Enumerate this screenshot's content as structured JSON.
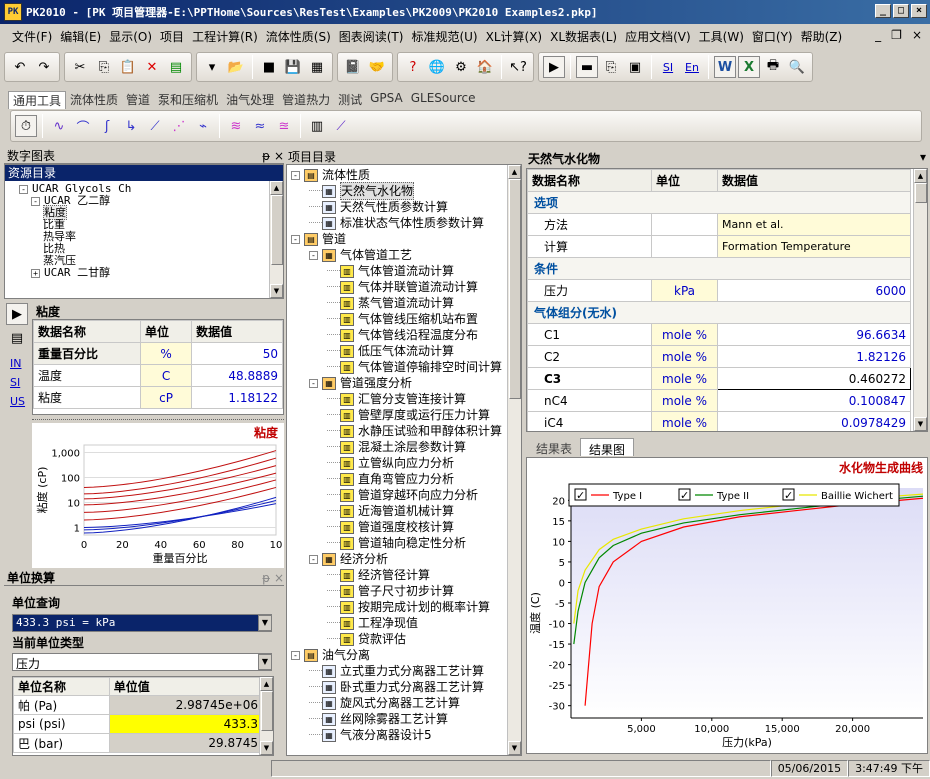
{
  "window": {
    "title": "PK2010 - [PK 项目管理器-E:\\PPTHome\\Sources\\ResTest\\Examples\\PK2009\\PK2010 Examples2.pkp]",
    "logo": "PK"
  },
  "menu": [
    "文件(F)",
    "编辑(E)",
    "显示(O)",
    "项目",
    "工程计算(R)",
    "流体性质(S)",
    "图表阅读(T)",
    "标准规范(U)",
    "XL计算(X)",
    "XL数据表(L)",
    "应用文档(V)",
    "工具(W)",
    "窗口(Y)",
    "帮助(Z)"
  ],
  "toolbar_tabs": [
    "通用工具",
    "流体性质",
    "管道",
    "泵和压缩机",
    "油气处理",
    "管道热力",
    "测试",
    "GPSA",
    "GLESource"
  ],
  "left_panel": {
    "title": "数字图表",
    "resource_header": "资源目录",
    "tree": [
      {
        "t": "UCAR Glycols Ch",
        "indent": 1,
        "exp": "-"
      },
      {
        "t": "UCAR 乙二醇",
        "indent": 2,
        "exp": "-"
      },
      {
        "t": "粘度",
        "indent": 3,
        "sel": true
      },
      {
        "t": "比重",
        "indent": 3
      },
      {
        "t": "热导率",
        "indent": 3
      },
      {
        "t": "比热",
        "indent": 3
      },
      {
        "t": "蒸汽压",
        "indent": 3
      },
      {
        "t": "UCAR 二甘醇",
        "indent": 2,
        "exp": "+"
      }
    ],
    "side_buttons": [
      "IN",
      "SI",
      "US"
    ],
    "viscosity_title": "粘度",
    "viscosity_table": {
      "headers": [
        "数据名称",
        "单位",
        "数据值"
      ],
      "rows": [
        [
          "重量百分比",
          "%",
          "50"
        ],
        [
          "温度",
          "C",
          "48.8889"
        ],
        [
          "粘度",
          "cP",
          "1.18122"
        ]
      ]
    },
    "chart_title": "粘度"
  },
  "unit_panel": {
    "title": "单位换算",
    "query_label": "单位查询",
    "query_value": "433.3 psi = kPa",
    "type_label": "当前单位类型",
    "type_value": "压力",
    "headers": [
      "单位名称",
      "单位值"
    ],
    "rows": [
      [
        "帕 (Pa)",
        "2.98745e+06"
      ],
      [
        "psi (psi)",
        "433.3"
      ],
      [
        "巴 (bar)",
        "29.8745"
      ]
    ]
  },
  "project": {
    "title": "项目目录",
    "items": [
      {
        "t": "流体性质",
        "lvl": 0,
        "exp": "-"
      },
      {
        "t": "天然气水化物",
        "lvl": 1,
        "sel": true
      },
      {
        "t": "天然气性质参数计算",
        "lvl": 1
      },
      {
        "t": "标准状态气体性质参数计算",
        "lvl": 1
      },
      {
        "t": "管道",
        "lvl": 0,
        "exp": "-"
      },
      {
        "t": "气体管道工艺",
        "lvl": 1,
        "exp": "-"
      },
      {
        "t": "气体管道流动计算",
        "lvl": 2
      },
      {
        "t": "气体并联管道流动计算",
        "lvl": 2
      },
      {
        "t": "蒸气管道流动计算",
        "lvl": 2
      },
      {
        "t": "气体管线压缩机站布置",
        "lvl": 2
      },
      {
        "t": "气体管线沿程温度分布",
        "lvl": 2
      },
      {
        "t": "低压气体流动计算",
        "lvl": 2
      },
      {
        "t": "气体管道停输排空时间计算",
        "lvl": 2
      },
      {
        "t": "管道强度分析",
        "lvl": 1,
        "exp": "-"
      },
      {
        "t": "汇管分支管连接计算",
        "lvl": 2
      },
      {
        "t": "管壁厚度或运行压力计算",
        "lvl": 2
      },
      {
        "t": "水静压试验和甲醇体积计算",
        "lvl": 2
      },
      {
        "t": "混凝土涂层参数计算",
        "lvl": 2
      },
      {
        "t": "立管纵向应力分析",
        "lvl": 2
      },
      {
        "t": "直角弯管应力分析",
        "lvl": 2
      },
      {
        "t": "管道穿越环向应力分析",
        "lvl": 2
      },
      {
        "t": "近海管道机械计算",
        "lvl": 2
      },
      {
        "t": "管道强度校核计算",
        "lvl": 2
      },
      {
        "t": "管道轴向稳定性分析",
        "lvl": 2
      },
      {
        "t": "经济分析",
        "lvl": 1,
        "exp": "-"
      },
      {
        "t": "经济管径计算",
        "lvl": 2
      },
      {
        "t": "管子尺寸初步计算",
        "lvl": 2
      },
      {
        "t": "按期完成计划的概率计算",
        "lvl": 2
      },
      {
        "t": "工程净现值",
        "lvl": 2
      },
      {
        "t": "贷款评估",
        "lvl": 2
      },
      {
        "t": "油气分离",
        "lvl": 0,
        "exp": "-"
      },
      {
        "t": "立式重力式分离器工艺计算",
        "lvl": 1
      },
      {
        "t": "卧式重力式分离器工艺计算",
        "lvl": 1
      },
      {
        "t": "旋风式分离器工艺计算",
        "lvl": 1
      },
      {
        "t": "丝网除雾器工艺计算",
        "lvl": 1
      },
      {
        "t": "气液分离器设计5",
        "lvl": 1
      }
    ]
  },
  "hydrate": {
    "title": "天然气水化物",
    "headers": [
      "数据名称",
      "单位",
      "数据值"
    ],
    "rows": [
      {
        "type": "section",
        "name": "选项"
      },
      {
        "type": "row",
        "name": "方法",
        "unit": "",
        "value": "Mann et al.",
        "text": true
      },
      {
        "type": "row",
        "name": "计算",
        "unit": "",
        "value": "Formation Temperature",
        "text": true
      },
      {
        "type": "section",
        "name": "条件"
      },
      {
        "type": "row",
        "name": "压力",
        "unit": "kPa",
        "value": "6000"
      },
      {
        "type": "section",
        "name": "气体组分(无水)"
      },
      {
        "type": "row",
        "name": "C1",
        "unit": "mole %",
        "value": "96.6634"
      },
      {
        "type": "row",
        "name": "C2",
        "unit": "mole %",
        "value": "1.82126"
      },
      {
        "type": "row",
        "name": "C3",
        "unit": "mole %",
        "value": "0.460272",
        "sel": true
      },
      {
        "type": "row",
        "name": "nC4",
        "unit": "mole %",
        "value": "0.100847"
      },
      {
        "type": "row",
        "name": "iC4",
        "unit": "mole %",
        "value": "0.0978429"
      }
    ]
  },
  "result_tabs": [
    "结果表",
    "结果图"
  ],
  "status": {
    "date": "05/06/2015",
    "time": "3:47:49 下午"
  },
  "chart_data": [
    {
      "type": "line",
      "title": "粘度",
      "xlabel": "重量百分比",
      "ylabel": "粘度 (cP)",
      "xlim": [
        0,
        100
      ],
      "ylog": true,
      "ylim": [
        0.5,
        2000
      ],
      "x_ticks": [
        "0",
        "20",
        "40",
        "60",
        "80",
        "10"
      ],
      "y_ticks": [
        "1,000",
        "100",
        "10",
        "1"
      ],
      "series": [
        {
          "x": [
            0,
            100
          ],
          "values": [
            1.0,
            9
          ]
        },
        {
          "x": [
            0,
            100
          ],
          "values": [
            0.8,
            12
          ]
        },
        {
          "x": [
            0,
            100
          ],
          "values": [
            0.6,
            16
          ]
        },
        {
          "x": [
            0,
            100
          ],
          "values": [
            2,
            40
          ]
        },
        {
          "x": [
            0,
            100
          ],
          "values": [
            4,
            80
          ]
        },
        {
          "x": [
            0,
            100
          ],
          "values": [
            8,
            150
          ]
        },
        {
          "x": [
            0,
            100
          ],
          "values": [
            14,
            300
          ]
        },
        {
          "x": [
            0,
            100
          ],
          "values": [
            22,
            600
          ]
        },
        {
          "x": [
            0,
            100
          ],
          "values": [
            40,
            1200
          ]
        }
      ]
    },
    {
      "type": "line",
      "title": "水化物生成曲线",
      "xlabel": "压力(kPa)",
      "ylabel": "温度 (C)",
      "xlim": [
        0,
        25000
      ],
      "ylim": [
        -33,
        23
      ],
      "x_ticks": [
        "5,000",
        "10,000",
        "15,000",
        "20,000"
      ],
      "y_ticks": [
        "20",
        "15",
        "10",
        "5",
        "0",
        "-5",
        "-10",
        "-15",
        "-20",
        "-25",
        "-30"
      ],
      "legend": "top-left",
      "series": [
        {
          "name": "Type I",
          "color": "#ff0000",
          "x": [
            1000,
            1500,
            2000,
            3000,
            5000,
            8000,
            12000,
            16000,
            20000,
            25000
          ],
          "values": [
            -30,
            -10,
            -1,
            5,
            10,
            13.5,
            16,
            17.5,
            19,
            20.5
          ]
        },
        {
          "name": "Type II",
          "color": "#008800",
          "x": [
            200,
            500,
            1000,
            2000,
            3000,
            5000,
            8000,
            12000,
            16000,
            20000,
            25000
          ],
          "values": [
            -15,
            -7,
            0,
            6,
            9,
            12,
            14.5,
            16.5,
            18,
            19.5,
            21
          ]
        },
        {
          "name": "Baillie Wichert",
          "color": "#e8e800",
          "x": [
            200,
            500,
            1000,
            2000,
            3000,
            5000,
            8000,
            12000,
            16000,
            20000,
            25000
          ],
          "values": [
            -10,
            -2,
            3,
            8,
            10.5,
            13,
            15.5,
            17.5,
            19,
            20.3,
            21.5
          ]
        }
      ]
    }
  ]
}
